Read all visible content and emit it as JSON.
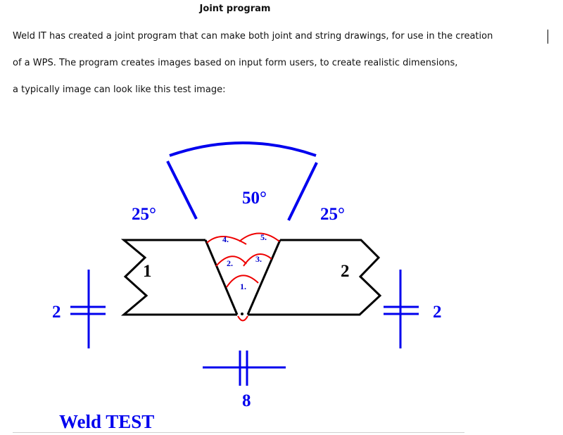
{
  "document": {
    "title": "Joint program",
    "paragraph_lines": [
      "Weld IT has created a joint program that can make both joint and string drawings, for use in the creation",
      "of a WPS. The program creates images based on input form users, to create realistic dimensions,",
      "a typically image can look like this test image:"
    ]
  },
  "figure": {
    "groove_angle_label": "50°",
    "left_bevel_label": "25°",
    "right_bevel_label": "25°",
    "left_plate_label": "1",
    "right_plate_label": "2",
    "left_thickness_label": "2",
    "right_thickness_label": "2",
    "root_gap_label": "8",
    "weld_passes": [
      "1.",
      "2.",
      "3.",
      "4.",
      "5."
    ],
    "caption": "Weld TEST",
    "colors": {
      "plate_outline": "#000000",
      "dimension": "#0000ee",
      "weld_pass": "#ee0000",
      "pass_label": "#0000cc"
    }
  }
}
